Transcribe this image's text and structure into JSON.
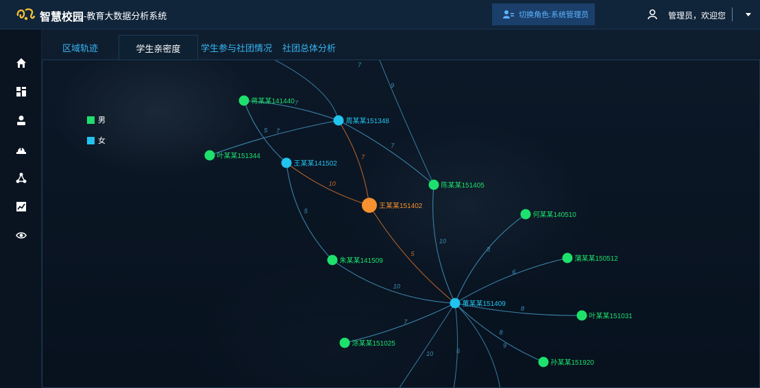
{
  "header": {
    "app_title": "智慧校园",
    "app_subtitle": "-教育大数据分析系统",
    "role_switch_label": "切换角色:系统管理员",
    "user_welcome": "管理员，欢迎您"
  },
  "sidebar": {
    "items": [
      {
        "name": "home-icon"
      },
      {
        "name": "dashboard-icon"
      },
      {
        "name": "user-icon"
      },
      {
        "name": "alert-icon"
      },
      {
        "name": "network-icon"
      },
      {
        "name": "chart-icon"
      },
      {
        "name": "eye-icon"
      }
    ]
  },
  "tabs": [
    {
      "label": "区域轨迹",
      "active": false
    },
    {
      "label": "学生亲密度",
      "active": true
    },
    {
      "label": "学生参与社团情况",
      "active": false
    },
    {
      "label": "社团总体分析",
      "active": false
    }
  ],
  "legend": [
    {
      "label": "男",
      "color": "#1de16c"
    },
    {
      "label": "女",
      "color": "#22c3ee"
    }
  ],
  "graph": {
    "colors": {
      "male": "#1de16c",
      "female": "#22c3ee",
      "center": "#f7902e",
      "edge": "#3f8fb8",
      "edge_center": "#c76a2a"
    },
    "nodes": [
      {
        "id": "wang151402",
        "label": "王某某151402",
        "gender": "center"
      },
      {
        "id": "jiang141440",
        "label": "蒋某某141440",
        "gender": "male"
      },
      {
        "id": "zhou151348",
        "label": "周某某151348",
        "gender": "female"
      },
      {
        "id": "ye151344",
        "label": "叶某某151344",
        "gender": "male"
      },
      {
        "id": "wang141502",
        "label": "王某某141502",
        "gender": "female"
      },
      {
        "id": "chen151405",
        "label": "陈某某151405",
        "gender": "male"
      },
      {
        "id": "he140510",
        "label": "何某某140510",
        "gender": "male"
      },
      {
        "id": "pu150512",
        "label": "蒲某某150512",
        "gender": "male"
      },
      {
        "id": "zhu141509",
        "label": "朱某某141509",
        "gender": "male"
      },
      {
        "id": "dong151409",
        "label": "董某某151409",
        "gender": "female"
      },
      {
        "id": "ye151031",
        "label": "叶某某151031",
        "gender": "male"
      },
      {
        "id": "tu151025",
        "label": "涂某某151025",
        "gender": "male"
      },
      {
        "id": "sun151920",
        "label": "孙某某151920",
        "gender": "male"
      }
    ],
    "edges": [
      {
        "source": "wang141502",
        "target": "wang151402",
        "weight": 10,
        "center": true
      },
      {
        "source": "zhou151348",
        "target": "wang151402",
        "weight": 7,
        "center": true
      },
      {
        "source": "dong151409",
        "target": "wang151402",
        "weight": 5,
        "center": true
      },
      {
        "source": "jiang141440",
        "target": "zhou151348",
        "weight": 7
      },
      {
        "source": "jiang141440",
        "target": "wang141502",
        "weight": 5
      },
      {
        "source": "ye151344",
        "target": "zhou151348",
        "weight": 7
      },
      {
        "source": "wang141502",
        "target": "zhu141509",
        "weight": 5
      },
      {
        "source": "zhou151348",
        "target": "chen151405",
        "weight": 7
      },
      {
        "source": "chen151405",
        "target": "dong151409",
        "weight": 10
      },
      {
        "source": "zhu141509",
        "target": "dong151409",
        "weight": 10
      },
      {
        "source": "dong151409",
        "target": "he140510",
        "weight": 8
      },
      {
        "source": "dong151409",
        "target": "pu150512",
        "weight": 6
      },
      {
        "source": "dong151409",
        "target": "ye151031",
        "weight": 8
      },
      {
        "source": "dong151409",
        "target": "sun151920",
        "weight": 8
      },
      {
        "source": "dong151409",
        "target": "tu151025",
        "weight": 7
      }
    ],
    "extra_edge_labels": [
      "7",
      "9",
      "10",
      "6",
      "9"
    ]
  }
}
